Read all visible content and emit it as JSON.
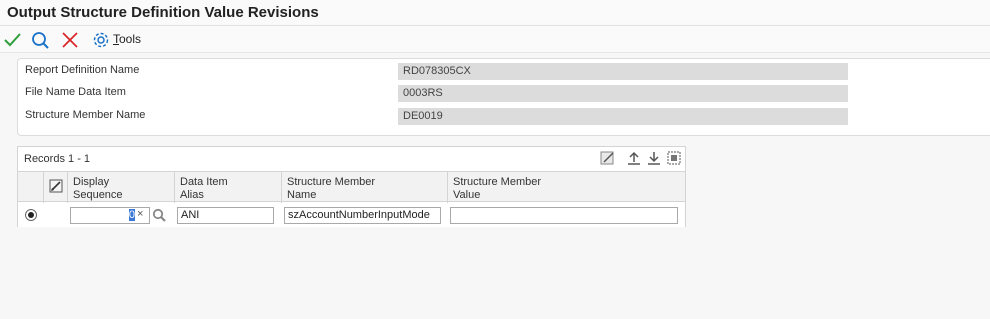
{
  "header": {
    "title": "Output Structure Definition Value Revisions"
  },
  "toolbar": {
    "icons": [
      "check-icon",
      "search-icon",
      "close-icon",
      "gear-icon"
    ],
    "tools_label_prefix": "T",
    "tools_label_rest": "ools"
  },
  "form": {
    "fields": [
      {
        "label": "Report Definition Name",
        "value": "RD078305CX"
      },
      {
        "label": "File Name Data Item",
        "value": "0003RS"
      },
      {
        "label": "Structure Member Name",
        "value": "DE0019"
      }
    ]
  },
  "grid": {
    "records_label": "Records 1 - 1",
    "columns": [
      {
        "line1": "Display",
        "line2": "Sequence"
      },
      {
        "line1": "Data Item",
        "line2": "Alias"
      },
      {
        "line1": "Structure Member",
        "line2": "Name"
      },
      {
        "line1": "Structure Member",
        "line2": "Value"
      }
    ],
    "rows": [
      {
        "display_sequence": "0",
        "data_item_alias": "ANI",
        "structure_member_name": "szAccountNumberInputMode",
        "structure_member_value": ""
      }
    ],
    "clear_glyph": "×"
  },
  "colors": {
    "accent": "#1a73c9",
    "check": "#2e9e3a",
    "close": "#d9262b"
  }
}
